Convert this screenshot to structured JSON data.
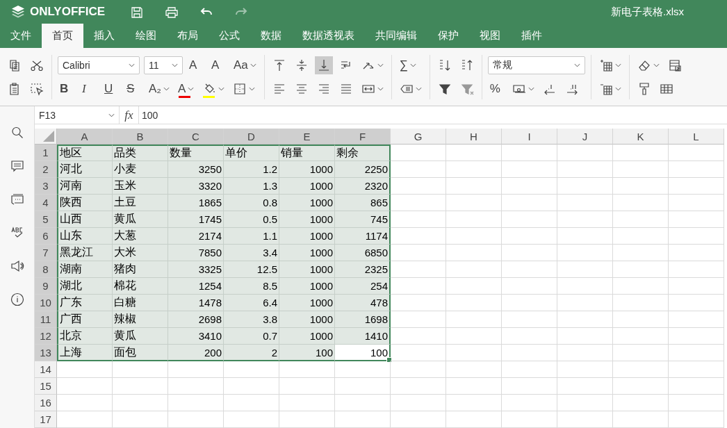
{
  "header": {
    "logo": "ONLYOFFICE",
    "file_name": "新电子表格.xlsx"
  },
  "tabs": [
    {
      "label": "文件",
      "selected": false
    },
    {
      "label": "首页",
      "selected": true
    },
    {
      "label": "插入",
      "selected": false
    },
    {
      "label": "绘图",
      "selected": false
    },
    {
      "label": "布局",
      "selected": false
    },
    {
      "label": "公式",
      "selected": false
    },
    {
      "label": "数据",
      "selected": false
    },
    {
      "label": "数据透视表",
      "selected": false
    },
    {
      "label": "共同编辑",
      "selected": false
    },
    {
      "label": "保护",
      "selected": false
    },
    {
      "label": "视图",
      "selected": false
    },
    {
      "label": "插件",
      "selected": false
    }
  ],
  "toolbar": {
    "font": "Calibri",
    "font_size": "11",
    "number_format": "常规",
    "increase_font": "A",
    "decrease_font": "A",
    "change_case": "Aa",
    "bold": "B",
    "italic": "I",
    "underline": "U",
    "strikethrough": "S",
    "subscript": "A₂",
    "font_color": "A",
    "sum": "∑",
    "percent": "%"
  },
  "formula_bar": {
    "cell_name": "F13",
    "fx": "fx",
    "value": "100"
  },
  "columns": [
    {
      "label": "A",
      "selected": true
    },
    {
      "label": "B",
      "selected": true
    },
    {
      "label": "C",
      "selected": true
    },
    {
      "label": "D",
      "selected": true
    },
    {
      "label": "E",
      "selected": true
    },
    {
      "label": "F",
      "selected": true
    },
    {
      "label": "G",
      "selected": false
    },
    {
      "label": "H",
      "selected": false
    },
    {
      "label": "I",
      "selected": false
    },
    {
      "label": "J",
      "selected": false
    },
    {
      "label": "K",
      "selected": false
    },
    {
      "label": "L",
      "selected": false
    }
  ],
  "rows": [
    {
      "label": "1",
      "selected": true,
      "kind": "header",
      "cells": [
        {
          "text": "地区",
          "active": false
        },
        {
          "text": "品类",
          "active": false
        },
        {
          "text": "数量",
          "active": false
        },
        {
          "text": "单价",
          "active": false
        },
        {
          "text": "销量",
          "active": false
        },
        {
          "text": "剩余",
          "active": false
        }
      ]
    },
    {
      "label": "2",
      "selected": true,
      "kind": "data",
      "cells": [
        {
          "text": "河北",
          "active": false
        },
        {
          "text": "小麦",
          "active": false
        },
        {
          "text": "3250",
          "active": false
        },
        {
          "text": "1.2",
          "active": false
        },
        {
          "text": "1000",
          "active": false
        },
        {
          "text": "2250",
          "active": false
        }
      ]
    },
    {
      "label": "3",
      "selected": true,
      "kind": "data",
      "cells": [
        {
          "text": "河南",
          "active": false
        },
        {
          "text": "玉米",
          "active": false
        },
        {
          "text": "3320",
          "active": false
        },
        {
          "text": "1.3",
          "active": false
        },
        {
          "text": "1000",
          "active": false
        },
        {
          "text": "2320",
          "active": false
        }
      ]
    },
    {
      "label": "4",
      "selected": true,
      "kind": "data",
      "cells": [
        {
          "text": "陕西",
          "active": false
        },
        {
          "text": "土豆",
          "active": false
        },
        {
          "text": "1865",
          "active": false
        },
        {
          "text": "0.8",
          "active": false
        },
        {
          "text": "1000",
          "active": false
        },
        {
          "text": "865",
          "active": false
        }
      ]
    },
    {
      "label": "5",
      "selected": true,
      "kind": "data",
      "cells": [
        {
          "text": "山西",
          "active": false
        },
        {
          "text": "黄瓜",
          "active": false
        },
        {
          "text": "1745",
          "active": false
        },
        {
          "text": "0.5",
          "active": false
        },
        {
          "text": "1000",
          "active": false
        },
        {
          "text": "745",
          "active": false
        }
      ]
    },
    {
      "label": "6",
      "selected": true,
      "kind": "data",
      "cells": [
        {
          "text": "山东",
          "active": false
        },
        {
          "text": "大葱",
          "active": false
        },
        {
          "text": "2174",
          "active": false
        },
        {
          "text": "1.1",
          "active": false
        },
        {
          "text": "1000",
          "active": false
        },
        {
          "text": "1174",
          "active": false
        }
      ]
    },
    {
      "label": "7",
      "selected": true,
      "kind": "data",
      "cells": [
        {
          "text": "黑龙江",
          "active": false
        },
        {
          "text": "大米",
          "active": false
        },
        {
          "text": "7850",
          "active": false
        },
        {
          "text": "3.4",
          "active": false
        },
        {
          "text": "1000",
          "active": false
        },
        {
          "text": "6850",
          "active": false
        }
      ]
    },
    {
      "label": "8",
      "selected": true,
      "kind": "data",
      "cells": [
        {
          "text": "湖南",
          "active": false
        },
        {
          "text": "猪肉",
          "active": false
        },
        {
          "text": "3325",
          "active": false
        },
        {
          "text": "12.5",
          "active": false
        },
        {
          "text": "1000",
          "active": false
        },
        {
          "text": "2325",
          "active": false
        }
      ]
    },
    {
      "label": "9",
      "selected": true,
      "kind": "data",
      "cells": [
        {
          "text": "湖北",
          "active": false
        },
        {
          "text": "棉花",
          "active": false
        },
        {
          "text": "1254",
          "active": false
        },
        {
          "text": "8.5",
          "active": false
        },
        {
          "text": "1000",
          "active": false
        },
        {
          "text": "254",
          "active": false
        }
      ]
    },
    {
      "label": "10",
      "selected": true,
      "kind": "data",
      "cells": [
        {
          "text": "广东",
          "active": false
        },
        {
          "text": "白糖",
          "active": false
        },
        {
          "text": "1478",
          "active": false
        },
        {
          "text": "6.4",
          "active": false
        },
        {
          "text": "1000",
          "active": false
        },
        {
          "text": "478",
          "active": false
        }
      ]
    },
    {
      "label": "11",
      "selected": true,
      "kind": "data",
      "cells": [
        {
          "text": "广西",
          "active": false
        },
        {
          "text": "辣椒",
          "active": false
        },
        {
          "text": "2698",
          "active": false
        },
        {
          "text": "3.8",
          "active": false
        },
        {
          "text": "1000",
          "active": false
        },
        {
          "text": "1698",
          "active": false
        }
      ]
    },
    {
      "label": "12",
      "selected": true,
      "kind": "data",
      "cells": [
        {
          "text": "北京",
          "active": false
        },
        {
          "text": "黄瓜",
          "active": false
        },
        {
          "text": "3410",
          "active": false
        },
        {
          "text": "0.7",
          "active": false
        },
        {
          "text": "1000",
          "active": false
        },
        {
          "text": "1410",
          "active": false
        }
      ]
    },
    {
      "label": "13",
      "selected": true,
      "kind": "data",
      "cells": [
        {
          "text": "上海",
          "active": false
        },
        {
          "text": "面包",
          "active": false
        },
        {
          "text": "200",
          "active": false
        },
        {
          "text": "2",
          "active": false
        },
        {
          "text": "100",
          "active": false
        },
        {
          "text": "100",
          "active": true
        }
      ]
    },
    {
      "label": "14",
      "selected": false,
      "kind": "data",
      "cells": []
    },
    {
      "label": "15",
      "selected": false,
      "kind": "data",
      "cells": []
    },
    {
      "label": "16",
      "selected": false,
      "kind": "data",
      "cells": []
    },
    {
      "label": "17",
      "selected": false,
      "kind": "data",
      "cells": []
    }
  ]
}
